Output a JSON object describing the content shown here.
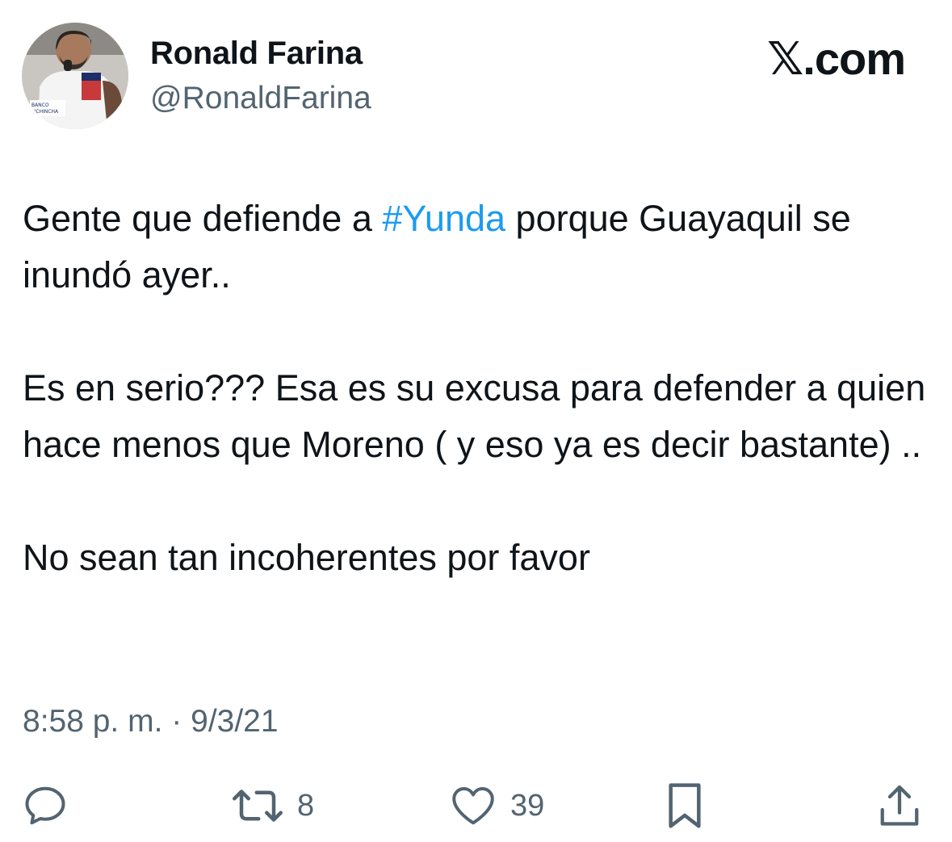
{
  "author": {
    "display_name": "Ronald Farina",
    "handle": "@RonaldFarina",
    "avatar_text": "BANCO PICHINCHA"
  },
  "brand": "𝕏.com",
  "tweet": {
    "line1_before": "Gente que defiende a ",
    "hashtag": "#Yunda",
    "line1_after": " porque Guayaquil se inundó ayer..",
    "paragraph2": "Es en serio??? Esa es su excusa para defender a quien hace menos que Moreno ( y eso ya es decir bastante) ..",
    "paragraph3": "No sean tan incoherentes por favor"
  },
  "meta": {
    "time": "8:58 p. m.",
    "separator": "·",
    "date": "9/3/21"
  },
  "actions": {
    "reply_icon": "reply-icon",
    "retweet_icon": "retweet-icon",
    "retweet_count": "8",
    "like_icon": "heart-icon",
    "like_count": "39",
    "bookmark_icon": "bookmark-icon",
    "share_icon": "share-icon"
  },
  "colors": {
    "text": "#0f1419",
    "secondary": "#536471",
    "link": "#1d9bf0"
  }
}
